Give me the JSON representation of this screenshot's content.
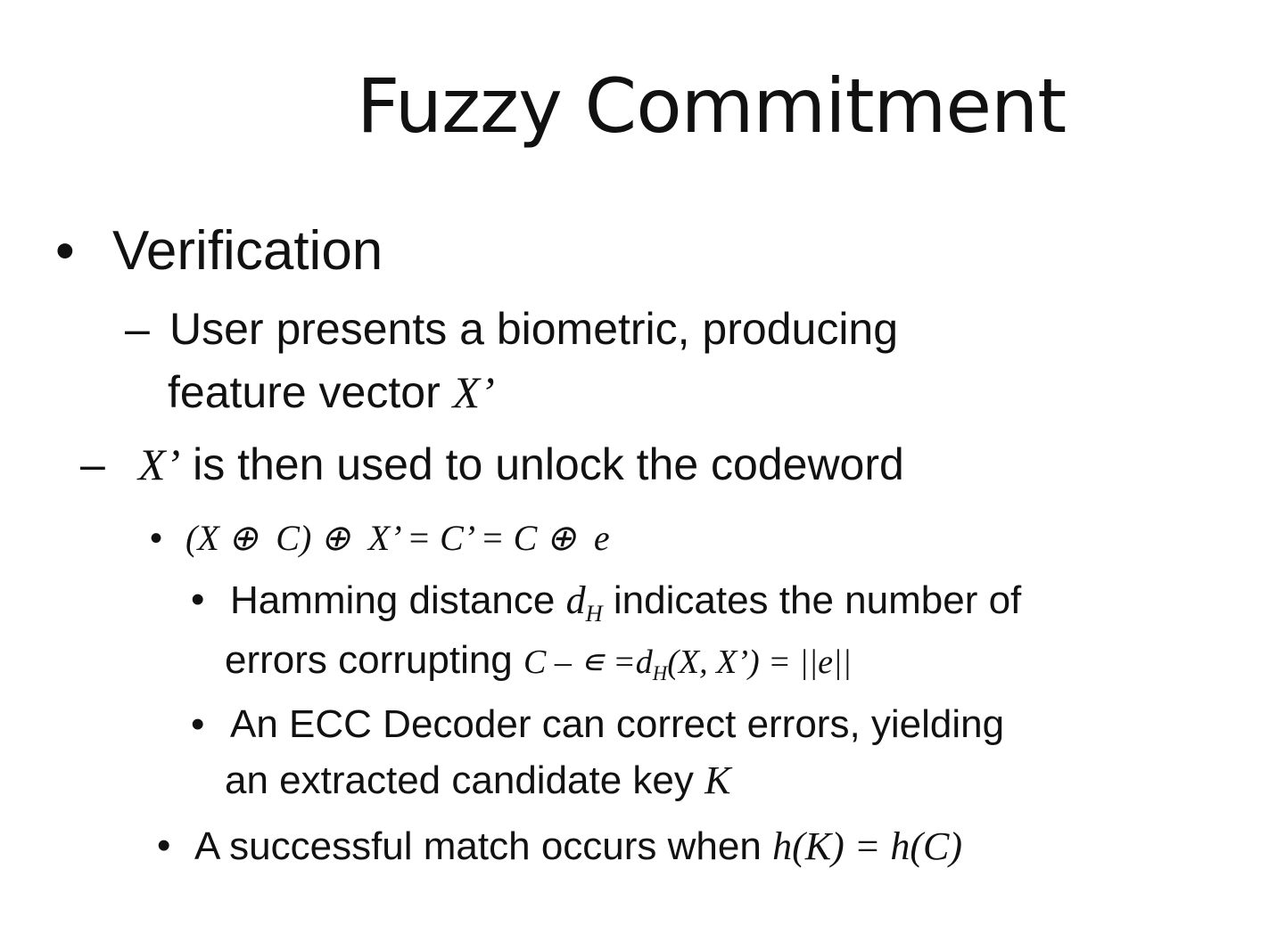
{
  "slide": {
    "title": "Fuzzy Commitment",
    "bullet_1": "Verification",
    "item_a_line1": "User presents a biometric, producing",
    "item_a_line2": "feature vector",
    "item_a_var": "X’",
    "item_b_var": "X’",
    "item_b_text": " is then used to unlock the codeword",
    "equation": "(X ⊕  C) ⊕  X’ = C’ = C ⊕  e",
    "hamming_line1_pre": "Hamming distance ",
    "hamming_d": "d",
    "hamming_sub": "H",
    "hamming_line1_post": " indicates the number of",
    "hamming_line2_text": "errors corrupting ",
    "hamming_line2_math_a": "C – ∊ =d",
    "hamming_line2_sub": "H",
    "hamming_line2_math_b": "(X, X’) = ||e||",
    "ecc_line1": "An ECC Decoder can correct errors, yielding",
    "ecc_line2": "an extracted candidate key ",
    "ecc_var": "K",
    "match_text": "A successful match occurs when ",
    "match_math": "h(K) = h(C)",
    "bullet_glyph": "•",
    "dash_glyph": "–"
  }
}
